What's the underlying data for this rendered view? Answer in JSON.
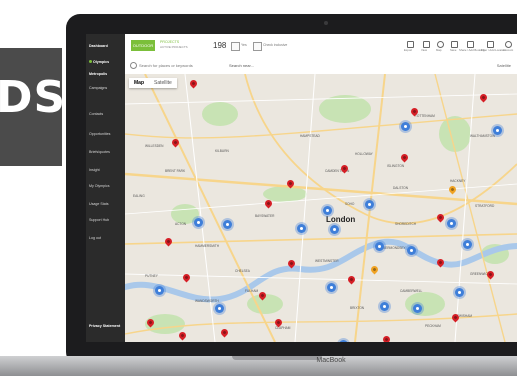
{
  "banner": {
    "text": "DS"
  },
  "device": {
    "brand": "MacBook"
  },
  "app": {
    "logo": "OUTDOOR",
    "projects_label": "PROJECTS",
    "projects_sub": "ACTIVE PROJECTS",
    "projects_count": "198",
    "chip1": "Yes",
    "chip2": "Check inclusive"
  },
  "sidebar": {
    "items": [
      {
        "label": "Dashboard"
      },
      {
        "label": "Olympics"
      },
      {
        "label": "Metropolis"
      },
      {
        "label": "Campaigns"
      },
      {
        "label": "Contacts"
      },
      {
        "label": "Opportunities"
      },
      {
        "label": "Briefs/quotes"
      },
      {
        "label": "Insight"
      },
      {
        "label": "My Olympics"
      },
      {
        "label": "Usage Stats"
      },
      {
        "label": "Support Hub"
      },
      {
        "label": "Log out"
      },
      {
        "label": "Privacy Statement"
      }
    ]
  },
  "toolbar": {
    "icons": [
      {
        "icon": "grid-icon",
        "label": "Export"
      },
      {
        "icon": "list-icon",
        "label": "View"
      },
      {
        "icon": "globe-icon",
        "label": "Map"
      },
      {
        "icon": "bookmark-icon",
        "label": "Save"
      },
      {
        "icon": "share-icon",
        "label": "Share / Add Booking"
      },
      {
        "icon": "filter-icon",
        "label": "Filter / Add Location"
      },
      {
        "icon": "user-icon",
        "label": "Account"
      }
    ]
  },
  "search": {
    "placeholder": "Search for places or keywords",
    "select": "Search near...",
    "right": "Satellite"
  },
  "map": {
    "tabs": [
      "Map",
      "Satellite"
    ],
    "city": "London",
    "districts": [
      "WILLESDEN",
      "KILBURN",
      "HAMPSTEAD",
      "CAMDEN TOWN",
      "HACKNEY",
      "ACTON",
      "BAYSWATER",
      "SOHO",
      "WESTMINSTER",
      "CHELSEA",
      "BRIXTON",
      "CAMBERWELL",
      "GREENWICH",
      "DALSTON",
      "CLAPHAM",
      "WANDSWORTH",
      "PUTNEY",
      "LEWISHAM",
      "STRATFORD",
      "SHOREDITCH",
      "BERMONDSEY",
      "PECKHAM",
      "HAMMERSMITH",
      "EALING",
      "HOLLOWAY",
      "ISLINGTON",
      "TOTTENHAM",
      "WALTHAMSTOW",
      "BRENT PARK",
      "FULHAM"
    ],
    "colors": {
      "road": "#f7d58b",
      "park": "#c8e3b4",
      "river": "#a9c8ea",
      "pin_red": "#d61f26",
      "marker_blue": "#3f7fd9"
    }
  }
}
